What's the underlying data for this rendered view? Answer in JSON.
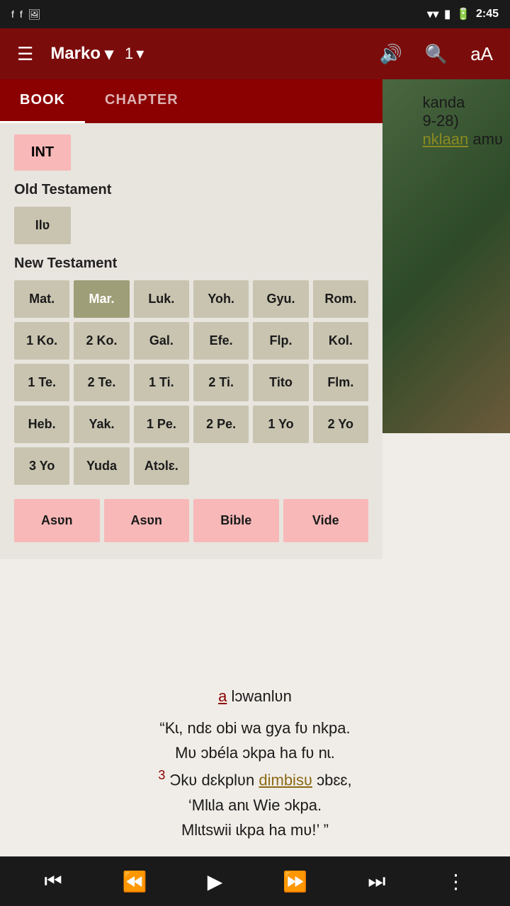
{
  "statusBar": {
    "time": "2:45",
    "icons": [
      "facebook1",
      "facebook2",
      "image"
    ]
  },
  "toolbar": {
    "menuIcon": "☰",
    "bookTitle": "Marko",
    "bookDropIcon": "▾",
    "chapterNum": "1",
    "chapterDropIcon": "▾",
    "volumeIcon": "🔊",
    "searchIcon": "🔍",
    "fontIcon": "aA"
  },
  "dropdown": {
    "tabs": [
      {
        "id": "book",
        "label": "BOOK",
        "active": true
      },
      {
        "id": "chapter",
        "label": "CHAPTER",
        "active": false
      }
    ],
    "intButton": "INT",
    "oldTestament": {
      "header": "Old Testament",
      "books": [
        "Ɩlʋ"
      ]
    },
    "newTestament": {
      "header": "New Testament",
      "books": [
        "Mat.",
        "Mar.",
        "Luk.",
        "Yoh.",
        "Gyu.",
        "Rom.",
        "1 Ko.",
        "2 Ko.",
        "Gal.",
        "Efe.",
        "Flp.",
        "Kol.",
        "1 Te.",
        "2 Te.",
        "1 Ti.",
        "2 Ti.",
        "Tito",
        "Flm.",
        "Heb.",
        "Yak.",
        "1 Pe.",
        "2 Pe.",
        "1 Yo",
        "2 Yo",
        "3 Yo",
        "Yuda",
        "Atɔlɛ."
      ]
    },
    "actionButtons": [
      "Asʋn",
      "Asʋn",
      "Bible",
      "Vide"
    ]
  },
  "mainContent": {
    "rightTopText1": "kanda",
    "rightTopText2": "9-28)",
    "rightTopAccent": "nklaan",
    "rightTopSuffix": " amʋ",
    "verseRef": "a",
    "verseRefSuffix": " lɔwanlʋn",
    "bibleText1": "“Kɩ, ndɛ obi wa gya fʋ nkpa.",
    "bibleText2": "Mʋ ɔbéla ɔkpa ha fʋ nɩ.",
    "verseNum3": "3",
    "bibleText3": "Ɔkʋ dɛkplʋn",
    "highlightWord": "dimbisʋ",
    "bibleText3b": " ɔbɛɛ,",
    "bibleText4": "‘Mlɩla anɩ Wie ɔkpa.",
    "bibleText5": "Mlɩtswii ɩkpa ha mʋ!’ ”"
  },
  "bottomNav": {
    "skipBackIcon": "⏮",
    "rewindIcon": "⏪",
    "playIcon": "▶",
    "fastForwardIcon": "⏩",
    "skipForwardIcon": "⏭",
    "moreIcon": "⋮"
  }
}
